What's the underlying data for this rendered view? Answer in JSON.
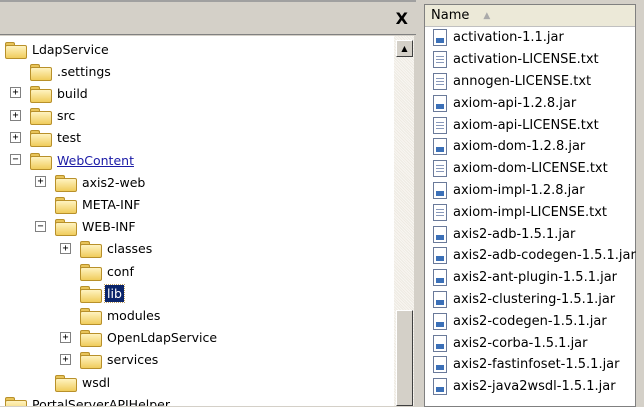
{
  "tree": {
    "items": [
      {
        "label": "LdapService",
        "level": 0,
        "expander": ""
      },
      {
        "label": ".settings",
        "level": 1,
        "expander": ""
      },
      {
        "label": "build",
        "level": 1,
        "expander": "+"
      },
      {
        "label": "src",
        "level": 1,
        "expander": "+"
      },
      {
        "label": "test",
        "level": 1,
        "expander": "+"
      },
      {
        "label": "WebContent",
        "level": 1,
        "expander": "-",
        "link": true
      },
      {
        "label": "axis2-web",
        "level": 2,
        "expander": "+"
      },
      {
        "label": "META-INF",
        "level": 2,
        "expander": ""
      },
      {
        "label": "WEB-INF",
        "level": 2,
        "expander": "-"
      },
      {
        "label": "classes",
        "level": 3,
        "expander": "+"
      },
      {
        "label": "conf",
        "level": 3,
        "expander": ""
      },
      {
        "label": "lib",
        "level": 3,
        "expander": "",
        "selected": true
      },
      {
        "label": "modules",
        "level": 3,
        "expander": ""
      },
      {
        "label": "OpenLdapService",
        "level": 3,
        "expander": "+"
      },
      {
        "label": "services",
        "level": 3,
        "expander": "+"
      },
      {
        "label": "wsdl",
        "level": 2,
        "expander": ""
      },
      {
        "label": "PortalServerAPIHelper",
        "level": 0,
        "expander": ""
      }
    ]
  },
  "close_label": "X",
  "files": {
    "header": "Name",
    "items": [
      {
        "name": "activation-1.1.jar",
        "type": "jar"
      },
      {
        "name": "activation-LICENSE.txt",
        "type": "txt"
      },
      {
        "name": "annogen-LICENSE.txt",
        "type": "txt"
      },
      {
        "name": "axiom-api-1.2.8.jar",
        "type": "jar"
      },
      {
        "name": "axiom-api-LICENSE.txt",
        "type": "txt"
      },
      {
        "name": "axiom-dom-1.2.8.jar",
        "type": "jar"
      },
      {
        "name": "axiom-dom-LICENSE.txt",
        "type": "txt"
      },
      {
        "name": "axiom-impl-1.2.8.jar",
        "type": "jar"
      },
      {
        "name": "axiom-impl-LICENSE.txt",
        "type": "txt"
      },
      {
        "name": "axis2-adb-1.5.1.jar",
        "type": "jar"
      },
      {
        "name": "axis2-adb-codegen-1.5.1.jar",
        "type": "jar"
      },
      {
        "name": "axis2-ant-plugin-1.5.1.jar",
        "type": "jar"
      },
      {
        "name": "axis2-clustering-1.5.1.jar",
        "type": "jar"
      },
      {
        "name": "axis2-codegen-1.5.1.jar",
        "type": "jar"
      },
      {
        "name": "axis2-corba-1.5.1.jar",
        "type": "jar"
      },
      {
        "name": "axis2-fastinfoset-1.5.1.jar",
        "type": "jar"
      },
      {
        "name": "axis2-java2wsdl-1.5.1.jar",
        "type": "jar"
      }
    ]
  }
}
